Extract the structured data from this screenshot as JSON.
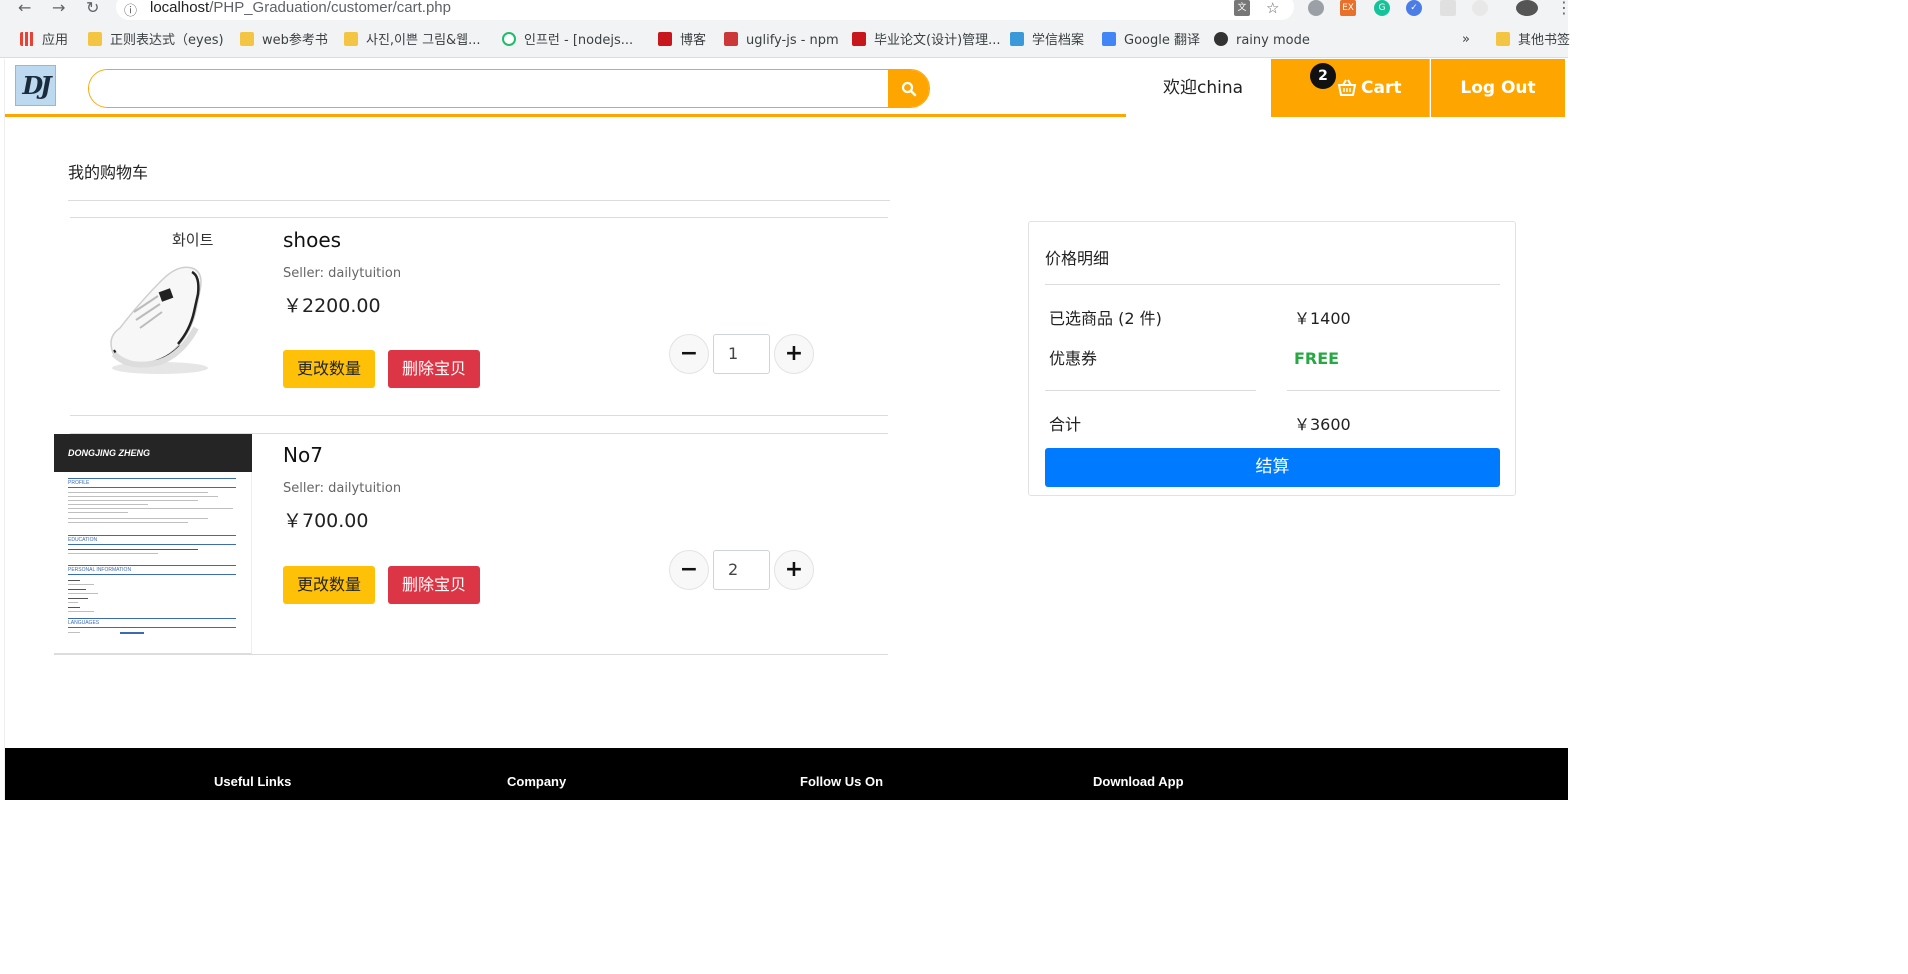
{
  "browser": {
    "url_host": "localhost",
    "url_path": "/PHP_Graduation/customer/cart.php",
    "bookmarks": [
      {
        "label": "应用",
        "icon": "apps-grid-icon"
      },
      {
        "label": "正则表达式（eyes)",
        "icon": "folder-icon"
      },
      {
        "label": "web参考书",
        "icon": "folder-icon"
      },
      {
        "label": "사진,이쁜 그림&웹...",
        "icon": "folder-icon"
      },
      {
        "label": "인프런 - [nodejs...",
        "icon": "inflearn-icon"
      },
      {
        "label": "博客",
        "icon": "csdn-icon"
      },
      {
        "label": "uglify-js - npm",
        "icon": "npm-icon"
      },
      {
        "label": "毕业论文(设计)管理...",
        "icon": "thesis-icon"
      },
      {
        "label": "学信档案",
        "icon": "chsi-icon"
      },
      {
        "label": "Google 翻译",
        "icon": "google-translate-icon"
      },
      {
        "label": "rainy mode",
        "icon": "rain-icon"
      }
    ],
    "overflow": "»",
    "other_bookmarks": "其他书签"
  },
  "header": {
    "welcome": "欢迎china",
    "cart_count": "2",
    "cart_label": "Cart",
    "logout_label": "Log Out",
    "search_placeholder": ""
  },
  "cart": {
    "title": "我的购物车",
    "items": [
      {
        "name": "shoes",
        "seller": "Seller: dailytuition",
        "price": "￥2200.00",
        "quantity": "1",
        "update_label": "更改数量",
        "delete_label": "删除宝贝",
        "image_caption": "화이트"
      },
      {
        "name": "No7",
        "seller": "Seller: dailytuition",
        "price": "￥700.00",
        "quantity": "2",
        "update_label": "更改数量",
        "delete_label": "删除宝贝",
        "image_name": "DONGJING ZHENG",
        "image_sections": [
          "PROFILE",
          "EDUCATION",
          "PERSONAL INFORMATION",
          "LANGUAGES"
        ]
      }
    ]
  },
  "summary": {
    "title": "价格明细",
    "selected_label": "已选商品 (2 件)",
    "selected_value": "￥1400",
    "coupon_label": "优惠券",
    "coupon_value": "FREE",
    "total_label": "合计",
    "total_value": "￥3600",
    "checkout_label": "结算"
  },
  "footer": {
    "links": [
      "Useful Links",
      "Company",
      "Follow Us On",
      "Download App"
    ]
  },
  "colors": {
    "accent": "#ffa500",
    "update_btn": "#ffc107",
    "delete_btn": "#dc3545",
    "checkout_btn": "#007bff",
    "free_text": "#28a745"
  }
}
